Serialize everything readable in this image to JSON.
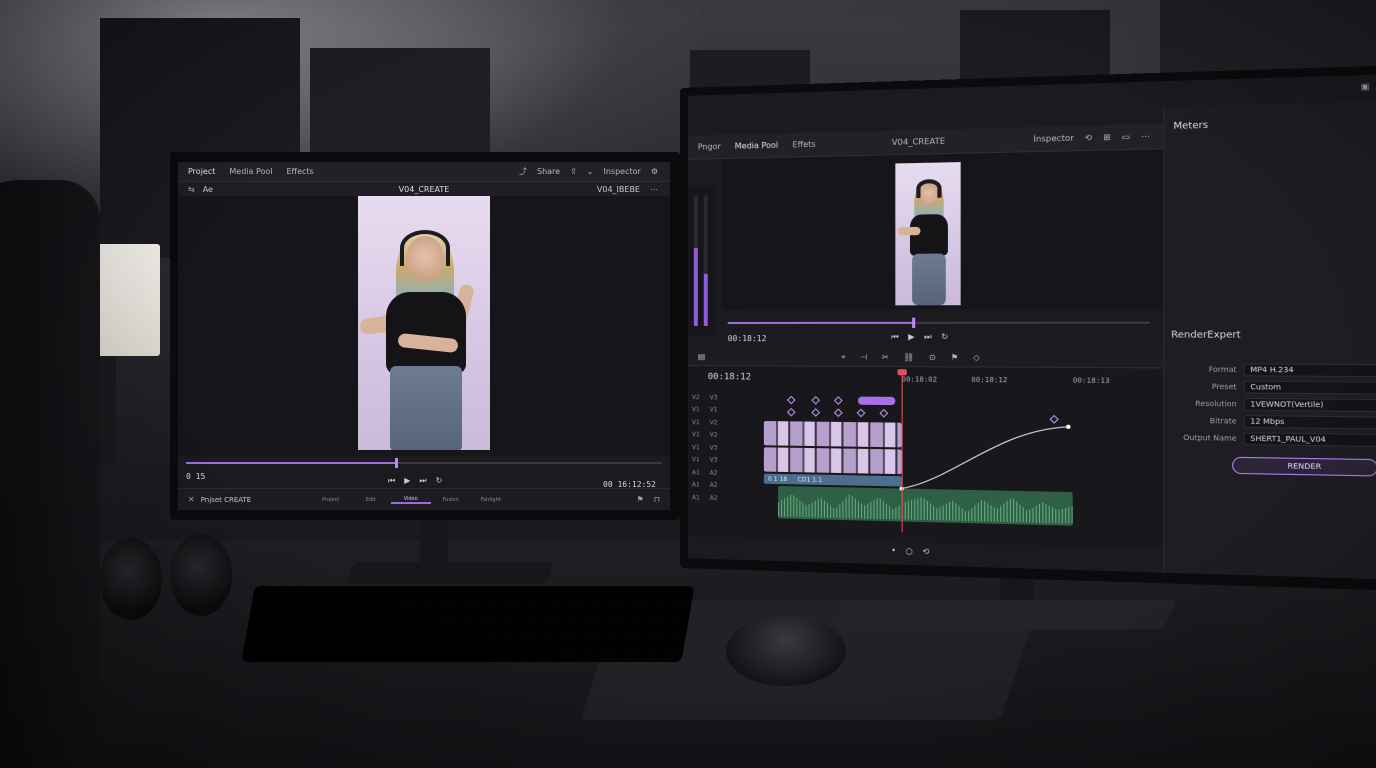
{
  "left_app": {
    "tabs": [
      "Project",
      "Media Pool",
      "Effects"
    ],
    "sub_left": "Ae",
    "title": "V04_CREATE",
    "share_label": "Share",
    "inspector_label": "Inspector",
    "clip_name": "V04_IBEBE",
    "timecode_in": "0 15",
    "timecode_out": "00 16:12:52",
    "project_name": "Pnjset CREATE",
    "progress": 0.44,
    "nav_items": [
      "Project",
      "Edit",
      "Video",
      "Fusion",
      "Fairlight"
    ]
  },
  "right_app": {
    "tabs": [
      "Pngor",
      "Media Pool",
      "Effets"
    ],
    "title": "V04_CREATE",
    "inspector_label": "Inspector",
    "meters_label": "Meters",
    "viewer_timecode": "00:18:12",
    "timeline_timecode": "00:18:12",
    "ruler_marks": [
      "00:18:02",
      "00:18:12",
      "00:18:13"
    ],
    "track_labels": [
      [
        "V2",
        "V3"
      ],
      [
        "V1",
        "V1"
      ],
      [
        "V1",
        "V2"
      ],
      [
        "V1",
        "V2"
      ],
      [
        "V1",
        "V3"
      ],
      [
        "V1",
        "V3"
      ],
      [
        "A1",
        "A2"
      ],
      [
        "A1",
        "A2"
      ],
      [
        "A1",
        "A2"
      ]
    ],
    "clip_labels": [
      "0 1 18",
      "CD1 1.1"
    ],
    "render_panel": {
      "title": "RenderExpert",
      "fields": [
        {
          "label": "Format",
          "value": "MP4 H.234"
        },
        {
          "label": "Preset",
          "value": "Custom"
        },
        {
          "label": "Resolution",
          "value": "1VEWNOT(Vertile)"
        },
        {
          "label": "Bitrate",
          "value": "12 Mbps"
        },
        {
          "label": "Output Name",
          "value": "SHERT1_PAUL_V04"
        }
      ],
      "render_label": "RENDER"
    }
  },
  "icons": {
    "more": "⋯",
    "play": "▶",
    "prev": "⏮",
    "next": "⏭",
    "loop": "↻",
    "gear": "⚙",
    "chevron": "⌄"
  },
  "colors": {
    "accent": "#a46be0",
    "playhead": "#e0505d",
    "audio": "#2f5f45"
  }
}
